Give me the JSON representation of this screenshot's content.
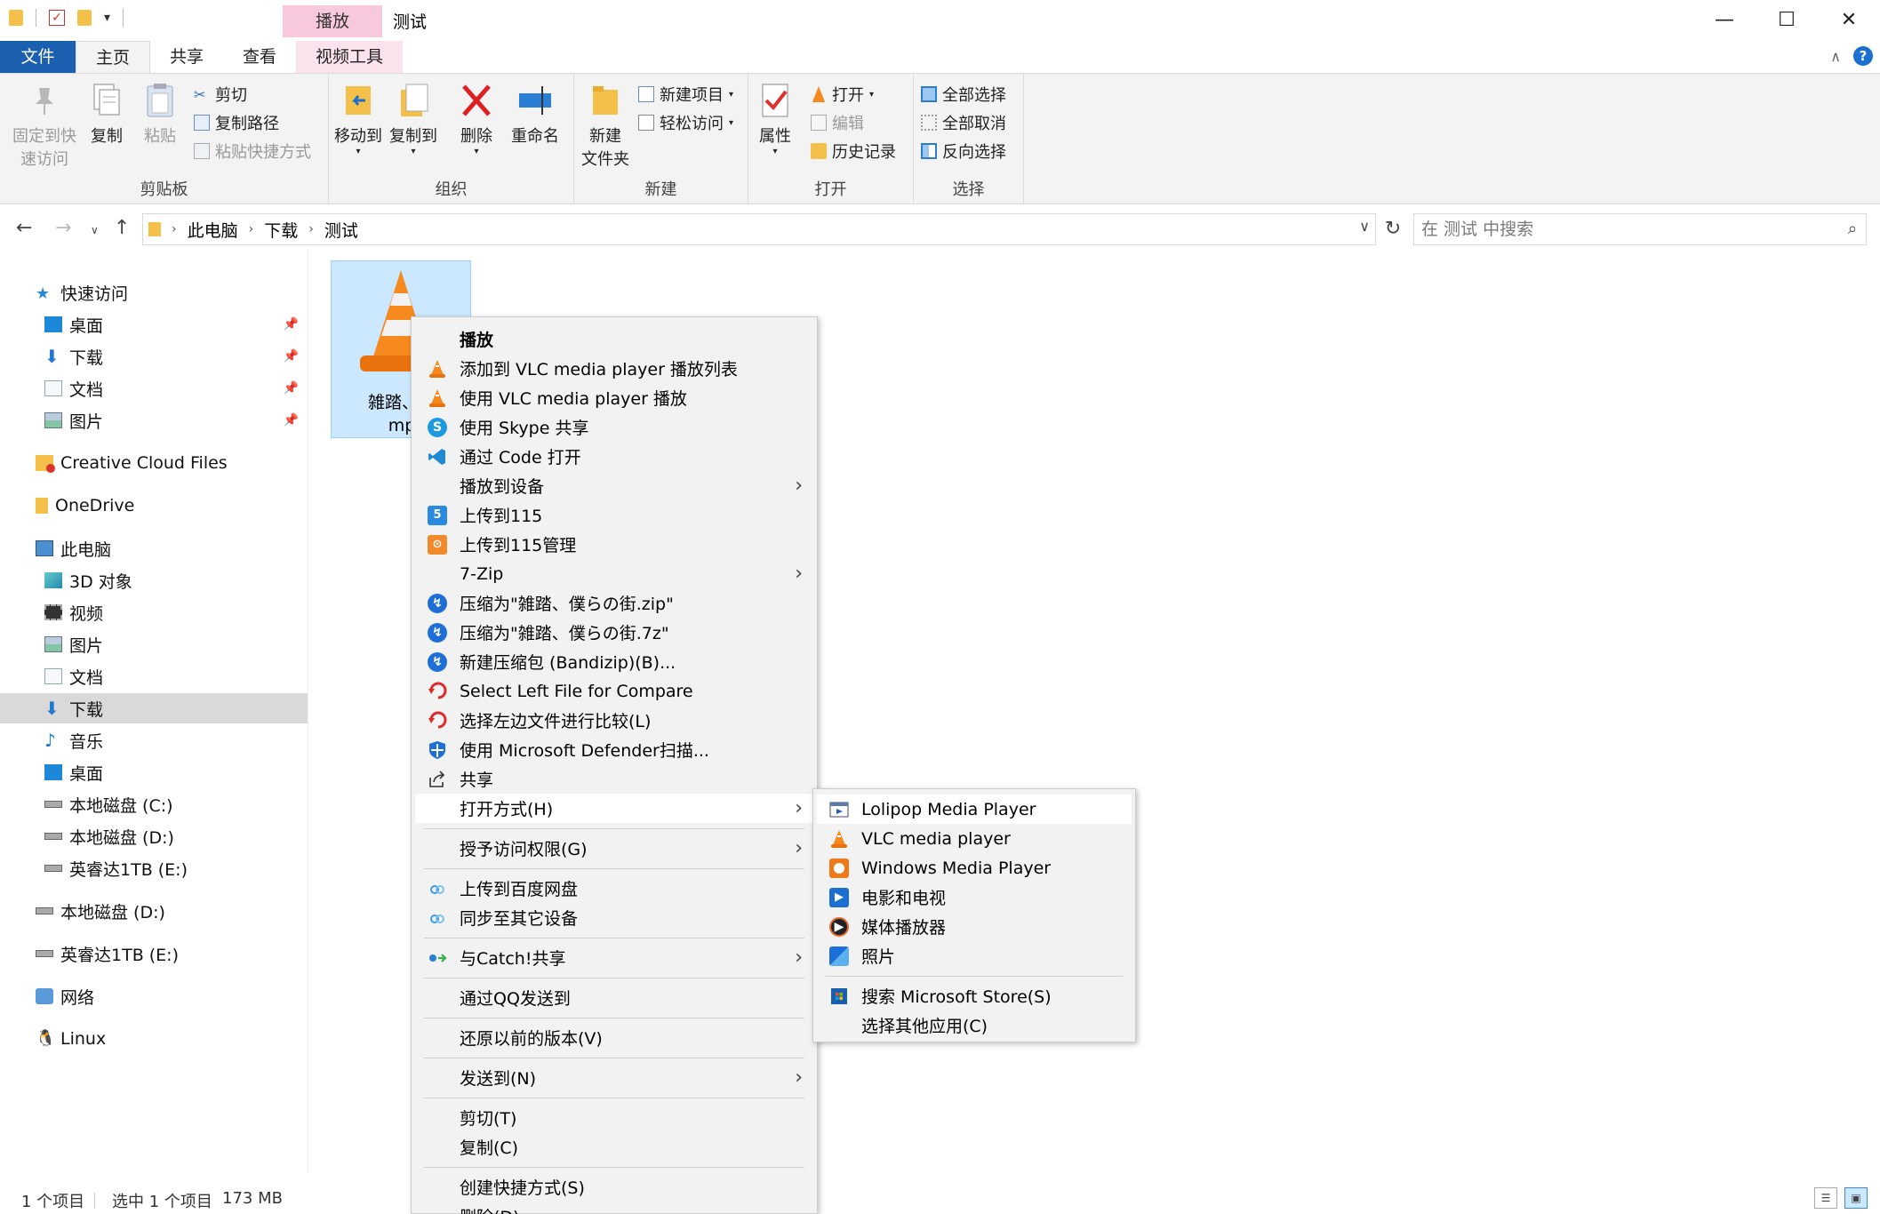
{
  "window": {
    "title": "测试",
    "contextual_tab_header": "播放",
    "controls": [
      "—",
      "☐",
      "✕"
    ]
  },
  "ribbon_tabs": [
    {
      "label": "文件"
    },
    {
      "label": "主页"
    },
    {
      "label": "共享"
    },
    {
      "label": "查看"
    },
    {
      "label": "视频工具"
    }
  ],
  "ribbon": {
    "clipboard": {
      "label": "剪贴板",
      "pin_quick": "固定到快速访问",
      "pin_quick_l1": "固定到快",
      "pin_quick_l2": "速访问",
      "copy": "复制",
      "paste": "粘贴",
      "cut": "剪切",
      "copy_path": "复制路径",
      "paste_shortcut": "粘贴快捷方式"
    },
    "organize": {
      "label": "组织",
      "move_to": "移动到",
      "copy_to": "复制到",
      "delete": "删除",
      "rename": "重命名"
    },
    "new": {
      "label": "新建",
      "new_folder_l1": "新建",
      "new_folder_l2": "文件夹",
      "new_item": "新建项目",
      "easy_access": "轻松访问"
    },
    "open": {
      "label": "打开",
      "properties": "属性",
      "open": "打开",
      "edit": "编辑",
      "history": "历史记录"
    },
    "select": {
      "label": "选择",
      "select_all": "全部选择",
      "select_none": "全部取消",
      "invert": "反向选择"
    }
  },
  "address": {
    "crumbs": [
      "此电脑",
      "下载",
      "测试"
    ],
    "search_placeholder": "在 测试 中搜索"
  },
  "nav": [
    {
      "label": "快速访问",
      "icon": "star-icon",
      "indent": 1,
      "pinned": false
    },
    {
      "label": "桌面",
      "icon": "desktop-icon",
      "indent": 2,
      "pinned": true
    },
    {
      "label": "下载",
      "icon": "download-icon",
      "indent": 2,
      "pinned": true
    },
    {
      "label": "文档",
      "icon": "document-icon",
      "indent": 2,
      "pinned": true
    },
    {
      "label": "图片",
      "icon": "pictures-icon",
      "indent": 2,
      "pinned": true
    },
    {
      "label": "Creative Cloud Files",
      "icon": "creative-cloud-icon",
      "indent": 1,
      "pinned": false
    },
    {
      "label": "OneDrive",
      "icon": "onedrive-icon",
      "indent": 1,
      "pinned": false
    },
    {
      "label": "此电脑",
      "icon": "computer-icon",
      "indent": 1,
      "pinned": false
    },
    {
      "label": "3D 对象",
      "icon": "3d-objects-icon",
      "indent": 2,
      "pinned": false
    },
    {
      "label": "视频",
      "icon": "videos-icon",
      "indent": 2,
      "pinned": false
    },
    {
      "label": "图片",
      "icon": "pictures-icon",
      "indent": 2,
      "pinned": false
    },
    {
      "label": "文档",
      "icon": "document-icon",
      "indent": 2,
      "pinned": false
    },
    {
      "label": "下载",
      "icon": "download-icon",
      "indent": 2,
      "pinned": false,
      "selected": true
    },
    {
      "label": "音乐",
      "icon": "music-icon",
      "indent": 2,
      "pinned": false
    },
    {
      "label": "桌面",
      "icon": "desktop-icon",
      "indent": 2,
      "pinned": false
    },
    {
      "label": "本地磁盘 (C:)",
      "icon": "drive-icon",
      "indent": 2,
      "pinned": false
    },
    {
      "label": "本地磁盘 (D:)",
      "icon": "drive-icon",
      "indent": 2,
      "pinned": false
    },
    {
      "label": "英睿达1TB (E:)",
      "icon": "drive-icon",
      "indent": 2,
      "pinned": false
    },
    {
      "label": "本地磁盘 (D:)",
      "icon": "drive-icon",
      "indent": 1,
      "pinned": false
    },
    {
      "label": "英睿达1TB (E:)",
      "icon": "drive-icon",
      "indent": 1,
      "pinned": false
    },
    {
      "label": "网络",
      "icon": "network-icon",
      "indent": 1,
      "pinned": false
    },
    {
      "label": "Linux",
      "icon": "linux-icon",
      "indent": 1,
      "pinned": false
    }
  ],
  "file": {
    "name_line1": "雑踏、僕",
    "name_line2": "mp"
  },
  "status": {
    "item_count": "1 个项目",
    "selected": "选中 1 个项目",
    "size": "173 MB"
  },
  "context_menu": [
    {
      "type": "item",
      "label": "播放",
      "icon": "none",
      "bold": true
    },
    {
      "type": "item",
      "label": "添加到 VLC media player 播放列表",
      "icon": "vlc-icon"
    },
    {
      "type": "item",
      "label": "使用 VLC media player 播放",
      "icon": "vlc-icon"
    },
    {
      "type": "item",
      "label": "使用 Skype 共享",
      "icon": "skype-icon"
    },
    {
      "type": "item",
      "label": "通过 Code 打开",
      "icon": "vscode-icon"
    },
    {
      "type": "item",
      "label": "播放到设备",
      "icon": "none",
      "submenu": true
    },
    {
      "type": "item",
      "label": "上传到115",
      "icon": "upload-115-icon"
    },
    {
      "type": "item",
      "label": "上传到115管理",
      "icon": "115-manage-icon"
    },
    {
      "type": "item",
      "label": "7-Zip",
      "icon": "none",
      "submenu": true
    },
    {
      "type": "item",
      "label": "压缩为\"雑踏、僕らの街.zip\"",
      "icon": "bandizip-icon"
    },
    {
      "type": "item",
      "label": "压缩为\"雑踏、僕らの街.7z\"",
      "icon": "bandizip-icon"
    },
    {
      "type": "item",
      "label": "新建压缩包 (Bandizip)(B)...",
      "icon": "bandizip-icon"
    },
    {
      "type": "item",
      "label": "Select Left File for Compare",
      "icon": "compare-icon"
    },
    {
      "type": "item",
      "label": "选择左边文件进行比较(L)",
      "icon": "compare-icon"
    },
    {
      "type": "item",
      "label": "使用 Microsoft Defender扫描...",
      "icon": "defender-icon"
    },
    {
      "type": "item",
      "label": "共享",
      "icon": "share-icon"
    },
    {
      "type": "item",
      "label": "打开方式(H)",
      "icon": "none",
      "submenu": true,
      "hover": true
    },
    {
      "type": "sep"
    },
    {
      "type": "item",
      "label": "授予访问权限(G)",
      "icon": "none",
      "submenu": true
    },
    {
      "type": "sep"
    },
    {
      "type": "item",
      "label": "上传到百度网盘",
      "icon": "baidu-icon"
    },
    {
      "type": "item",
      "label": "同步至其它设备",
      "icon": "baidu-icon"
    },
    {
      "type": "sep"
    },
    {
      "type": "item",
      "label": "与Catch!共享",
      "icon": "catch-icon",
      "submenu": true
    },
    {
      "type": "sep"
    },
    {
      "type": "item",
      "label": "通过QQ发送到",
      "icon": "none"
    },
    {
      "type": "sep"
    },
    {
      "type": "item",
      "label": "还原以前的版本(V)",
      "icon": "none"
    },
    {
      "type": "sep"
    },
    {
      "type": "item",
      "label": "发送到(N)",
      "icon": "none",
      "submenu": true
    },
    {
      "type": "sep"
    },
    {
      "type": "item",
      "label": "剪切(T)",
      "icon": "none"
    },
    {
      "type": "item",
      "label": "复制(C)",
      "icon": "none"
    },
    {
      "type": "sep"
    },
    {
      "type": "item",
      "label": "创建快捷方式(S)",
      "icon": "none"
    },
    {
      "type": "item",
      "label": "删除(D)",
      "icon": "none"
    }
  ],
  "open_with_submenu": [
    {
      "type": "item",
      "label": "Lolipop Media Player",
      "icon": "lolipop-icon",
      "hover": true
    },
    {
      "type": "item",
      "label": "VLC media player",
      "icon": "vlc-icon"
    },
    {
      "type": "item",
      "label": "Windows Media Player",
      "icon": "wmp-icon"
    },
    {
      "type": "item",
      "label": "电影和电视",
      "icon": "movies-tv-icon"
    },
    {
      "type": "item",
      "label": "媒体播放器",
      "icon": "media-player-icon"
    },
    {
      "type": "item",
      "label": "照片",
      "icon": "photos-icon"
    },
    {
      "type": "sep"
    },
    {
      "type": "item",
      "label": "搜索 Microsoft Store(S)",
      "icon": "store-icon"
    },
    {
      "type": "item",
      "label": "选择其他应用(C)",
      "icon": "none"
    }
  ],
  "colors": {
    "file_tab": "#1a5fb0",
    "selection": "#cce8ff",
    "vlc_orange": "#f68a1e",
    "contextual_tab": "#f8c8dc"
  }
}
